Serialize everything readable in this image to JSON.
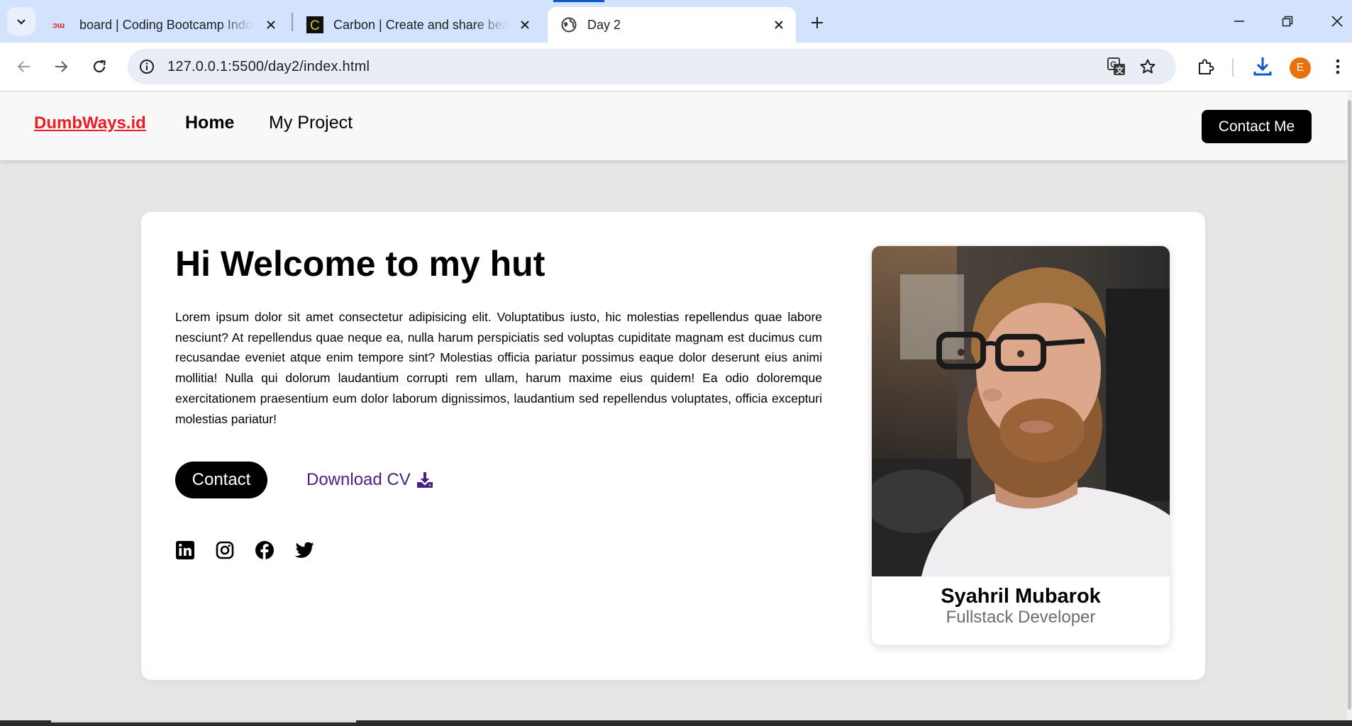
{
  "browser": {
    "tabs": [
      {
        "title": "board | Coding Bootcamp Indonesia",
        "favicon": "dumbways-favicon"
      },
      {
        "title": "Carbon | Create and share beautiful images of your source code",
        "favicon": "carbon-favicon"
      },
      {
        "title": "Day 2",
        "favicon": "globe-icon",
        "active": true
      }
    ],
    "url": "127.0.0.1:5500/day2/index.html",
    "profile_initial": "E",
    "accent_color": "#0b57d0"
  },
  "site": {
    "brand": "DumbWays.id",
    "brand_color": "#ee1c24",
    "nav": {
      "home": "Home",
      "project": "My Project"
    },
    "contact_me": "Contact Me"
  },
  "hero": {
    "headline": "Hi Welcome to my hut",
    "paragraph": "Lorem ipsum dolor sit amet consectetur adipisicing elit. Voluptatibus iusto, hic molestias repellendus quae labore nesciunt? At repellendus quae neque ea, nulla harum perspiciatis sed voluptas cupiditate magnam est ducimus cum recusandae eveniet atque enim tempore sint? Molestias officia pariatur possimus eaque dolor deserunt eius animi mollitia! Nulla qui dolorum laudantium corrupti rem ullam, harum maxime eius quidem! Ea odio doloremque exercitationem praesentium eum dolor laborum dignissimos, laudantium sed repellendus voluptates, officia excepturi molestias pariatur!",
    "contact_button": "Contact",
    "download_cv": "Download CV",
    "download_color": "#4c1f86",
    "socials": [
      "linkedin-icon",
      "instagram-icon",
      "facebook-icon",
      "twitter-icon"
    ]
  },
  "profile": {
    "name": "Syahril Mubarok",
    "role": "Fullstack Developer"
  }
}
